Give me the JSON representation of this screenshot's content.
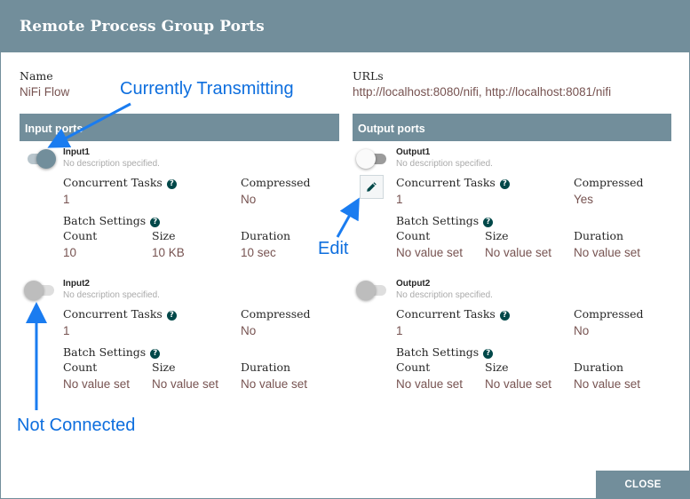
{
  "dialog": {
    "title": "Remote Process Group Ports",
    "name_label": "Name",
    "name_value": "NiFi Flow",
    "urls_label": "URLs",
    "urls_value": "http://localhost:8080/nifi, http://localhost:8081/nifi",
    "close_label": "CLOSE"
  },
  "input_ports": {
    "header": "Input ports",
    "ports": [
      {
        "name": "Input1",
        "description": "No description specified.",
        "transmitting": true,
        "concurrent_tasks_label": "Concurrent Tasks",
        "concurrent_tasks": "1",
        "compressed_label": "Compressed",
        "compressed": "No",
        "batch_label": "Batch Settings",
        "count_label": "Count",
        "count": "10",
        "size_label": "Size",
        "size": "10 KB",
        "duration_label": "Duration",
        "duration": "10 sec"
      },
      {
        "name": "Input2",
        "description": "No description specified.",
        "transmitting": false,
        "concurrent_tasks_label": "Concurrent Tasks",
        "concurrent_tasks": "1",
        "compressed_label": "Compressed",
        "compressed": "No",
        "batch_label": "Batch Settings",
        "count_label": "Count",
        "count": "No value set",
        "size_label": "Size",
        "size": "No value set",
        "duration_label": "Duration",
        "duration": "No value set"
      }
    ]
  },
  "output_ports": {
    "header": "Output ports",
    "ports": [
      {
        "name": "Output1",
        "description": "No description specified.",
        "transmitting": false,
        "concurrent_tasks_label": "Concurrent Tasks",
        "concurrent_tasks": "1",
        "compressed_label": "Compressed",
        "compressed": "Yes",
        "batch_label": "Batch Settings",
        "count_label": "Count",
        "count": "No value set",
        "size_label": "Size",
        "size": "No value set",
        "duration_label": "Duration",
        "duration": "No value set"
      },
      {
        "name": "Output2",
        "description": "No description specified.",
        "transmitting": false,
        "concurrent_tasks_label": "Concurrent Tasks",
        "concurrent_tasks": "1",
        "compressed_label": "Compressed",
        "compressed": "No",
        "batch_label": "Batch Settings",
        "count_label": "Count",
        "count": "No value set",
        "size_label": "Size",
        "size": "No value set",
        "duration_label": "Duration",
        "duration": "No value set"
      }
    ]
  },
  "annotations": {
    "transmitting": "Currently Transmitting",
    "edit": "Edit",
    "not_connected": "Not Connected"
  },
  "icons": {
    "help": "?",
    "edit": "pencil-icon"
  },
  "colors": {
    "header_bg": "#728e9b",
    "value_text": "#775351",
    "help_icon": "#004849",
    "annotation": "#0d6ede"
  }
}
